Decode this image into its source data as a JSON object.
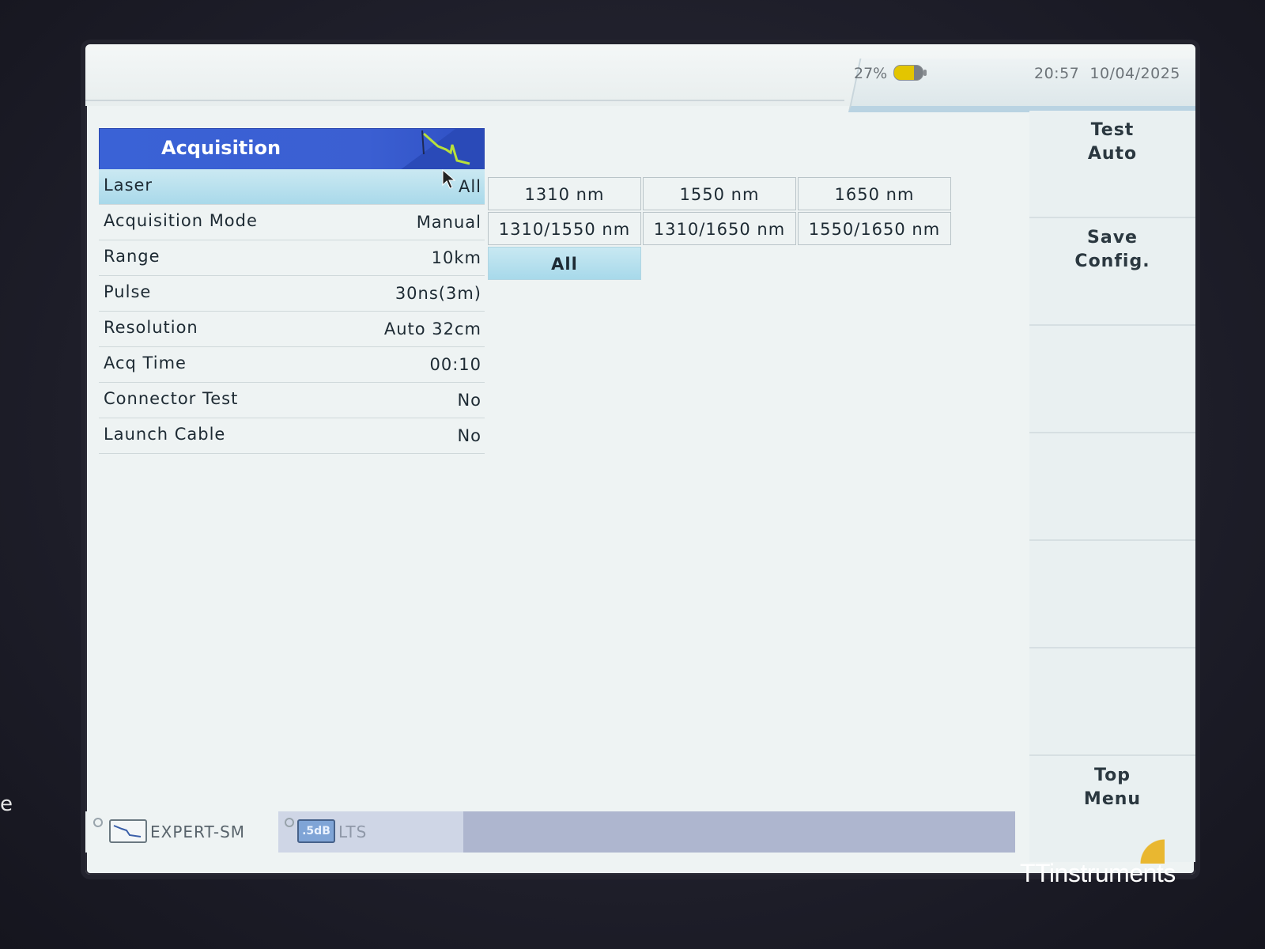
{
  "status": {
    "battery_percent": "27%",
    "time": "20:57",
    "date": "10/04/2025"
  },
  "panel": {
    "title": "Acquisition",
    "rows": [
      {
        "label": "Laser",
        "value": "All",
        "selected": true
      },
      {
        "label": "Acquisition Mode",
        "value": "Manual"
      },
      {
        "label": "Range",
        "value": "10km"
      },
      {
        "label": "Pulse",
        "value": "30ns(3m)"
      },
      {
        "label": "Resolution",
        "value": "Auto 32cm"
      },
      {
        "label": "Acq Time",
        "value": "00:10"
      },
      {
        "label": "Connector Test",
        "value": "No"
      },
      {
        "label": "Launch Cable",
        "value": "No"
      }
    ]
  },
  "laser_options": {
    "row1": [
      "1310 nm",
      "1550 nm",
      "1650 nm"
    ],
    "row2": [
      "1310/1550 nm",
      "1310/1650 nm",
      "1550/1650 nm"
    ],
    "all": "All",
    "selected": "All"
  },
  "softkeys": {
    "test_auto": [
      "Test",
      "Auto"
    ],
    "save_config": [
      "Save",
      "Config."
    ],
    "top_menu": [
      "Top",
      "Menu"
    ]
  },
  "tabs": {
    "expert": "EXPERT-SM",
    "lts_icon": ".5dB",
    "lts": "LTS"
  },
  "bezel_text": "e",
  "watermark": "TTinstruments",
  "colors": {
    "header_blue": "#3a62d6",
    "selected_row": "#a9d9ea",
    "battery_yellow": "#e3c500"
  }
}
